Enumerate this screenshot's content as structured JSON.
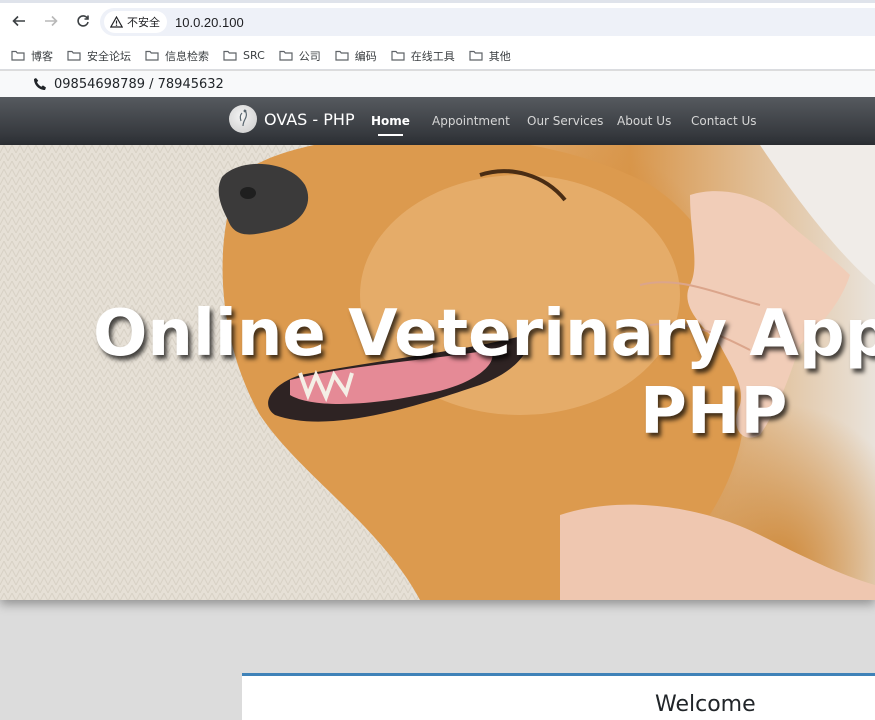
{
  "browser": {
    "security_label": "不安全",
    "url": "10.0.20.100",
    "bookmarks": [
      "博客",
      "安全论坛",
      "信息检索",
      "SRC",
      "公司",
      "编码",
      "在线工具",
      "其他"
    ]
  },
  "topbar": {
    "phone": "09854698789 / 78945632"
  },
  "navbar": {
    "brand": "OVAS - PHP",
    "items": [
      "Home",
      "Appointment",
      "Our Services",
      "About Us",
      "Contact Us"
    ]
  },
  "hero": {
    "title_line1": "Online Veterinary Appoint",
    "title_line2": "PHP"
  },
  "welcome": {
    "title": "Welcome"
  },
  "colors": {
    "accent": "#3f82b8",
    "navbar_top": "#565a5f",
    "navbar_bottom": "#2d3035"
  }
}
